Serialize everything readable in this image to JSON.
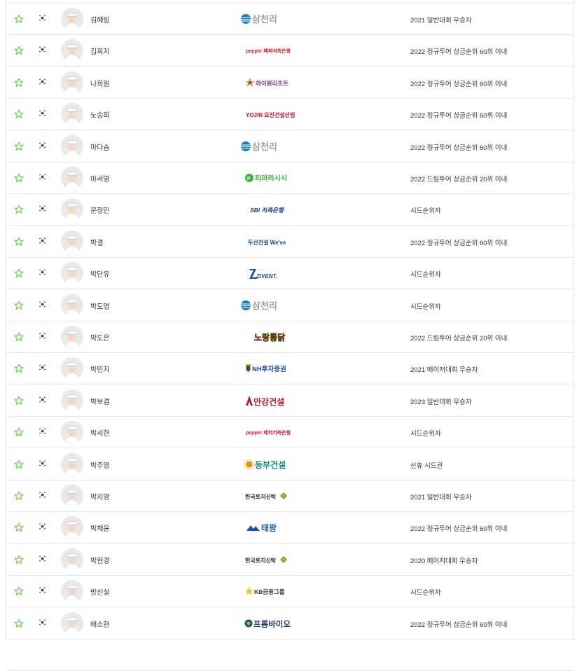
{
  "colors": {
    "star": "#63c84a",
    "border": "#e5e5e5",
    "text": "#333333"
  },
  "icons": {
    "favorite": "star-outline-icon",
    "nationality": "korea-flag-icon"
  },
  "players": [
    {
      "name": "김혜림",
      "sponsor": "삼천리",
      "sponsor_logo": "samchully",
      "qualification": "2021 일반대회 우승자"
    },
    {
      "name": "김희지",
      "sponsor": "pepper 페퍼저축은행",
      "sponsor_logo": "pepper",
      "qualification": "2022 정규투어 상금순위 60위 이내"
    },
    {
      "name": "나희원",
      "sponsor": "하이원리조트",
      "sponsor_logo": "high1",
      "qualification": "2022 정규투어 상금순위 60위 이내"
    },
    {
      "name": "노승희",
      "sponsor": "YOJIN 요진건설산업",
      "sponsor_logo": "yojin",
      "qualification": "2022 정규투어 상금순위 60위 이내"
    },
    {
      "name": "마다솜",
      "sponsor": "삼천리",
      "sponsor_logo": "samchully",
      "qualification": "2022 정규투어 상금순위 60위 이내"
    },
    {
      "name": "마서영",
      "sponsor": "피마리시시",
      "sponsor_logo": "pimarisisi",
      "qualification": "2022 드림투어 상금순위 20위 이내"
    },
    {
      "name": "문정민",
      "sponsor": "SBI 저축은행",
      "sponsor_logo": "sbi",
      "qualification": "시드순위자"
    },
    {
      "name": "박결",
      "sponsor": "두산건설 We've",
      "sponsor_logo": "doosan",
      "qualification": "2022 정규투어 상금순위 60위 이내"
    },
    {
      "name": "박단유",
      "sponsor": "ZIVENT.",
      "sponsor_logo": "zivent",
      "qualification": "시드순위자"
    },
    {
      "name": "박도영",
      "sponsor": "삼천리",
      "sponsor_logo": "samchully",
      "qualification": "시드순위자"
    },
    {
      "name": "박도은",
      "sponsor": "노랑통닭",
      "sponsor_logo": "norang",
      "qualification": "2022 드림투어 상금순위 20위 이내"
    },
    {
      "name": "박민지",
      "sponsor": "NH투자증권",
      "sponsor_logo": "nh",
      "qualification": "2021 메이저대회 우승자"
    },
    {
      "name": "박보겸",
      "sponsor": "안강건설",
      "sponsor_logo": "angang",
      "qualification": "2023 일반대회 우승자"
    },
    {
      "name": "박서현",
      "sponsor": "pepper 페퍼저축은행",
      "sponsor_logo": "pepper",
      "qualification": "시드순위자"
    },
    {
      "name": "박주영",
      "sponsor": "동부건설",
      "sponsor_logo": "dongbu",
      "qualification": "산휴 시드권"
    },
    {
      "name": "박지영",
      "sponsor": "한국토지신탁",
      "sponsor_logo": "koreit",
      "qualification": "2021 일반대회 우승자"
    },
    {
      "name": "박채윤",
      "sponsor": "태왕",
      "sponsor_logo": "taewang",
      "qualification": "2022 정규투어 상금순위 60위 이내"
    },
    {
      "name": "박현경",
      "sponsor": "한국토지신탁",
      "sponsor_logo": "koreit",
      "qualification": "2020 메이저대회 우승자"
    },
    {
      "name": "방신실",
      "sponsor": "KB금융그룹",
      "sponsor_logo": "kb",
      "qualification": "시드순위자"
    },
    {
      "name": "배소현",
      "sponsor": "프롬바이오",
      "sponsor_logo": "frombio",
      "qualification": "2022 정규투어 상금순위 60위 이내"
    }
  ]
}
